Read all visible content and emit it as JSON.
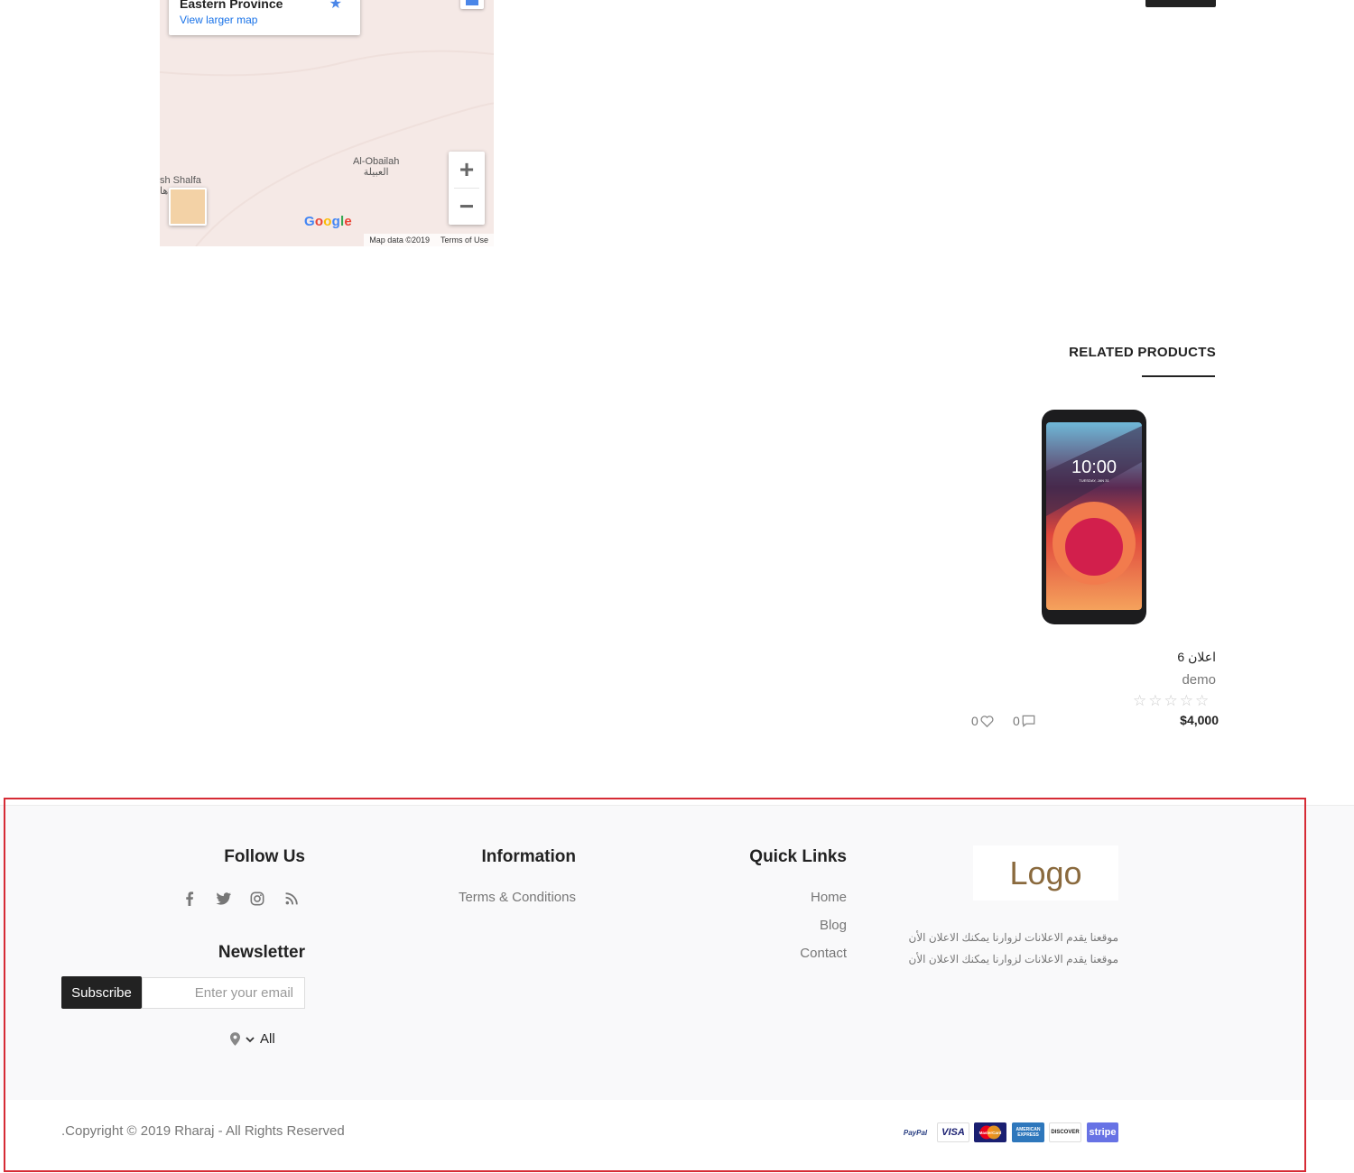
{
  "map": {
    "place_title": "Eastern Province",
    "larger_map_link": "View larger map",
    "label_obailah_en": "Al-Obailah",
    "label_obailah_ar": "العبيلة",
    "label_shalfa": "sh Shalfa",
    "label_shalfa_ar": "ها",
    "zoom_in": "+",
    "zoom_out": "−",
    "google_brand": "Google",
    "map_data": "Map data ©2019",
    "terms": "Terms of Use"
  },
  "related": {
    "title": "RELATED PRODUCTS",
    "product": {
      "name": "اعلان 6",
      "vendor": "demo",
      "rating_stars": "☆☆☆☆☆",
      "rating": 0,
      "price": "$4,000",
      "likes": "0",
      "comments": "0",
      "screen_time": "10:00",
      "screen_date": "TUESDAY, JAN 31"
    }
  },
  "footer": {
    "follow_title": "Follow Us",
    "information_title": "Information",
    "information_links": [
      "Terms & Conditions"
    ],
    "quick_title": "Quick Links",
    "quick_links": [
      "Home",
      "Blog",
      "Contact"
    ],
    "logo_text": "Logo",
    "about_text": "موقعنا يقدم الاعلانات لزوارنا يمكنك الاعلان الأن موقعنا يقدم الاعلانات لزوارنا يمكنك الاعلان الأن",
    "newsletter_title": "Newsletter",
    "subscribe_label": "Subscribe",
    "email_placeholder": "Enter your email",
    "location_label": "All",
    "copyright": ".Copyright © 2019 Rharaj - All Rights Reserved",
    "payments": [
      "PayPal",
      "VISA",
      "MasterCard",
      "AMERICAN EXPRESS",
      "DISCOVER",
      "stripe"
    ]
  },
  "colors": {
    "accent_dark": "#222222",
    "highlight_frame": "#d62b35",
    "logo_color": "#8a6a3e"
  }
}
